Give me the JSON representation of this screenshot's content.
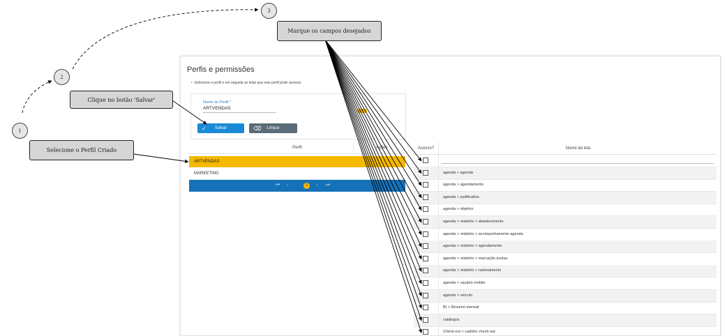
{
  "page": {
    "title": "Perfis e permissões",
    "description": "Selecione o perfil e em seguida as telas que este perfil pode acessar."
  },
  "form": {
    "field_label": "Nome do Perfil *",
    "field_value": "ARTVENDAS",
    "save_label": "Salvar",
    "clear_label": "Limpar"
  },
  "profiles_table": {
    "header": "Perfil",
    "header2": "Ações",
    "rows": [
      "ARTVENDAS",
      "MARKETING"
    ],
    "pager": {
      "first": "⏮",
      "prev": "‹",
      "current": "1",
      "next": "›",
      "last": "⏭"
    }
  },
  "permissions_table": {
    "header_access": "Acesso?",
    "header_name": "Nome da tela",
    "rows": [
      "",
      "agenda > agenda",
      "agenda > agendamento",
      "agenda > justificativa",
      "agenda > objetivo",
      "agenda > relatório > abastecimento",
      "agenda > relatório > acompanhamento agenda",
      "agenda > relatório > agendamento",
      "agenda > relatório > marcação avulsa",
      "agenda > relatório > rastreamento",
      "agenda > usuário mobile",
      "agenda > veículo",
      "BI > Resumo mensal",
      "catálogos",
      "Check-out > cadstro check-out"
    ]
  },
  "annotations": {
    "callout_fields": "Marque os campos desejados",
    "callout_save": "Clique no botão 'Salvar'",
    "callout_select": "Selecione o Perfil Criado",
    "step1": "1",
    "step2": "2",
    "step3": "3"
  },
  "colors": {
    "accent_blue": "#1b8ad6",
    "pager_blue": "#1672b8",
    "selected_yellow": "#f5b800",
    "clear_gray": "#5b6b77"
  },
  "icons": {
    "save": "check-icon",
    "clear": "eraser-icon"
  }
}
